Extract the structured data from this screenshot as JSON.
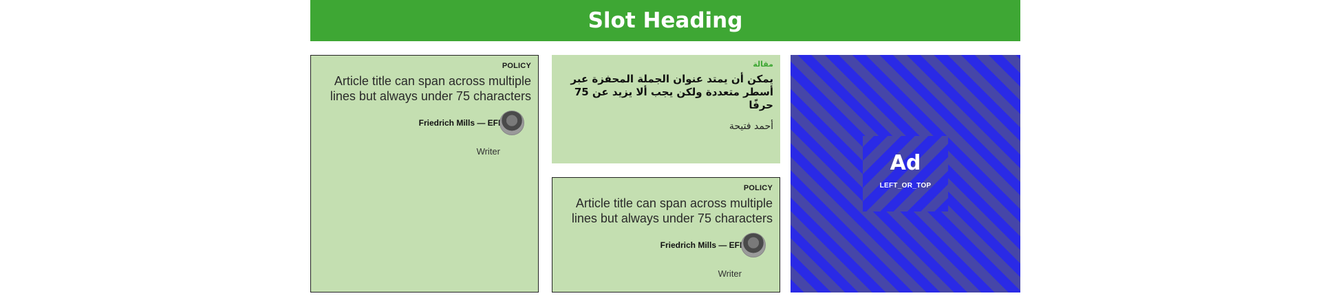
{
  "slot": {
    "heading": "Slot Heading"
  },
  "cards": [
    {
      "kicker": "POLICY",
      "title": "Article title can span across multiple lines but always under 75 characters",
      "author": "Friedrich Mills — EFE",
      "role": "Writer"
    },
    {
      "kicker": "مقالة",
      "title": "يمكن أن يمتد عنوان الجملة المحفزة عبر أسطر متعددة ولكن يجب ألا يزيد عن 75 حرفًا",
      "author": "أحمد فتيحة"
    },
    {
      "kicker": "POLICY",
      "title": "Article title can span across multiple lines but always under 75 characters",
      "author": "Friedrich Mills — EFE",
      "role": "Writer"
    }
  ],
  "ad": {
    "label": "Ad",
    "position": "LEFT_OR_TOP"
  },
  "colors": {
    "accent": "#3ea734",
    "card_bg": "#c4dfb1",
    "ad_blue": "#2a2ae6"
  },
  "icons": {
    "avatar": "author-avatar"
  }
}
